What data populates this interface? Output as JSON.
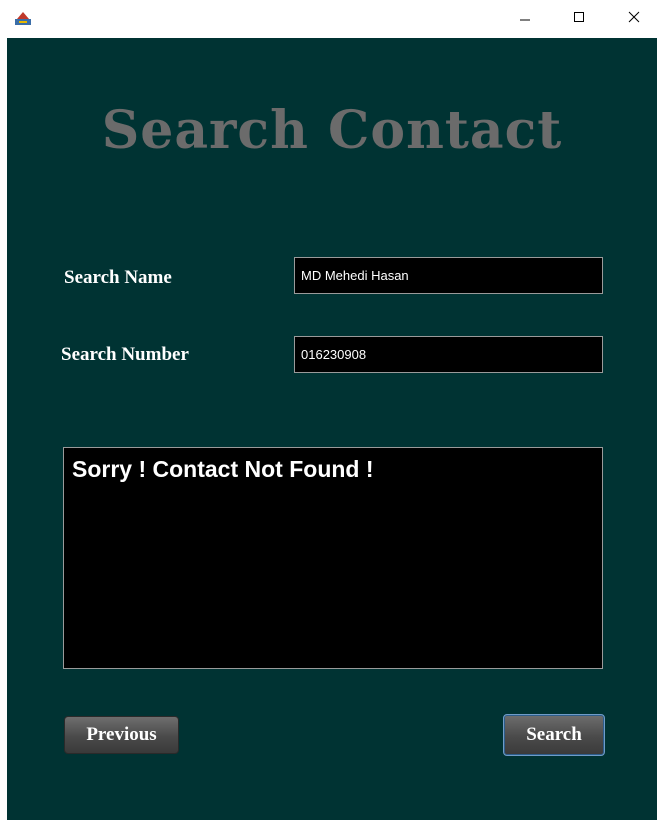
{
  "window": {
    "title_icon": "java-app-icon",
    "controls": {
      "minimize_icon": "minimize-icon",
      "maximize_icon": "maximize-icon",
      "close_icon": "close-icon"
    }
  },
  "main": {
    "heading": "Search Contact",
    "search_name": {
      "label": "Search Name",
      "value": "MD Mehedi Hasan"
    },
    "search_number": {
      "label": "Search Number",
      "value": "016230908"
    },
    "result": {
      "text": "Sorry ! Contact Not Found !"
    },
    "buttons": {
      "previous_label": "Previous",
      "search_label": "Search"
    }
  },
  "colors": {
    "background": "#003333",
    "heading": "#6b6b6b",
    "field_background": "#000000",
    "text": "#ffffff"
  }
}
